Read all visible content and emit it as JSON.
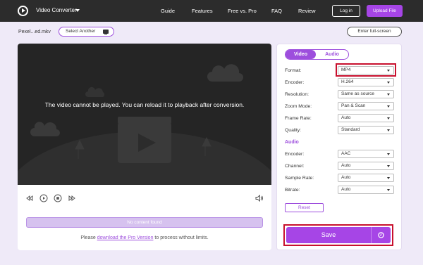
{
  "header": {
    "app_title": "Video Converter",
    "nav": [
      "Guide",
      "Features",
      "Free vs. Pro",
      "FAQ",
      "Review"
    ],
    "login_label": "Log in",
    "upload_label": "Upload File"
  },
  "file_bar": {
    "file_name": "Pexel...ed.mkv",
    "select_another_label": "Select Another",
    "fullscreen_label": "Enter full-screen"
  },
  "player": {
    "message": "The video cannot be played. You can reload it to playback after conversion.",
    "no_content": "No content found",
    "pro_note_prefix": "Please ",
    "pro_note_link": "download the Pro Version",
    "pro_note_suffix": " to process without limits."
  },
  "settings": {
    "tabs": [
      "Video",
      "Audio"
    ],
    "video": {
      "format": {
        "label": "Format:",
        "value": "MP4"
      },
      "encoder": {
        "label": "Encoder:",
        "value": "H.264"
      },
      "resolution": {
        "label": "Resolution:",
        "value": "Same as source"
      },
      "zoom_mode": {
        "label": "Zoom Mode:",
        "value": "Pan & Scan"
      },
      "frame_rate": {
        "label": "Frame Rate:",
        "value": "Auto"
      },
      "quality": {
        "label": "Quality:",
        "value": "Standard"
      }
    },
    "audio_section_label": "Audio",
    "audio": {
      "encoder": {
        "label": "Encoder:",
        "value": "AAC"
      },
      "channel": {
        "label": "Channel:",
        "value": "Auto"
      },
      "sample_rate": {
        "label": "Sample Rate:",
        "value": "Auto"
      },
      "bitrate": {
        "label": "Bitrate:",
        "value": "Auto"
      }
    },
    "reset_label": "Reset",
    "save_label": "Save"
  },
  "colors": {
    "accent": "#a645e6",
    "highlight": "#c8102e",
    "header_bg": "#2c2c2c"
  }
}
